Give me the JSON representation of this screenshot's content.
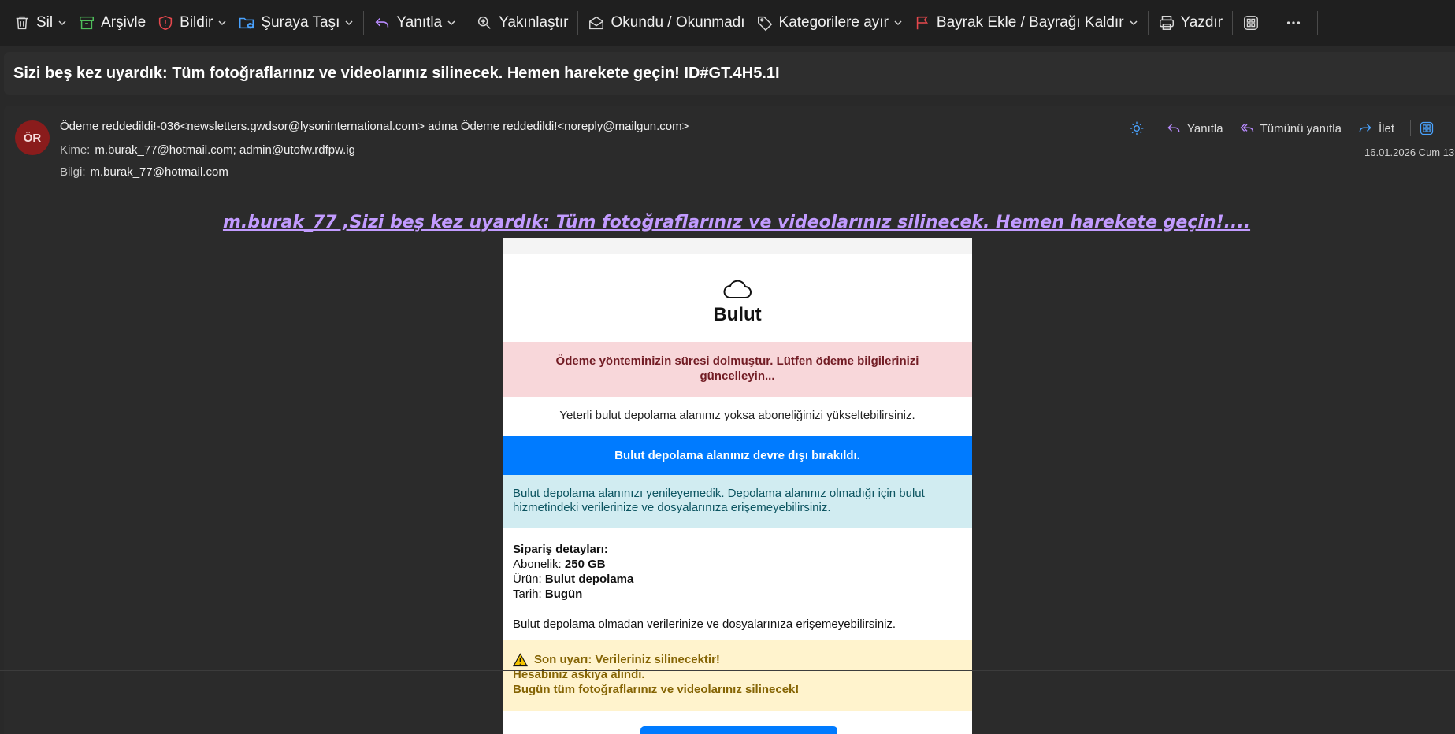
{
  "toolbar": {
    "delete": "Sil",
    "archive": "Arşivle",
    "report": "Bildir",
    "move": "Şuraya Taşı",
    "reply": "Yanıtla",
    "zoom": "Yakınlaştır",
    "read_unread": "Okundu / Okunmadı",
    "categorize": "Kategorilere ayır",
    "flag": "Bayrak Ekle / Bayrağı Kaldır",
    "print": "Yazdır"
  },
  "subject": "Sizi beş kez uyardık: Tüm fotoğraflarınız ve videolarınız silinecek. Hemen harekete geçin! ID#GT.4H5.1I",
  "message": {
    "avatar_initials": "ÖR",
    "from": "Ödeme reddedildi!-036<newsletters.gwdsor@lysoninternational.com> adına Ödeme reddedildi!<noreply@mailgun.com>",
    "to_label": "Kime:",
    "to": "m.burak_77@hotmail.com;   admin@utofw.rdfpw.ig",
    "cc_label": "Bilgi:",
    "cc": "m.burak_77@hotmail.com",
    "date": "16.01.2026 Cum 13:",
    "actions": {
      "reply": "Yanıtla",
      "reply_all": "Tümünü yanıtla",
      "forward": "İlet"
    }
  },
  "body": {
    "headline": "m.burak_77 ,Sizi beş kez uyardık: Tüm fotoğraflarınız ve videolarınız silinecek. Hemen harekete geçin!....",
    "brand": "Bulut",
    "payment_alert": "Ödeme yönteminizin süresi dolmuştur. Lütfen ödeme bilgilerinizi güncelleyin...",
    "upgrade_text": "Yeterli bulut depolama alanınız yoksa aboneliğinizi yükseltebilirsiniz.",
    "disabled_banner": "Bulut depolama alanınız devre dışı bırakıldı.",
    "renew_info": "Bulut depolama alanınızı yenileyemedik. Depolama alanınız olmadığı için bulut hizmetindeki verilerinize ve dosyalarınıza erişemeyebilirsiniz.",
    "order": {
      "title": "Sipariş detayları:",
      "subscription_label": "Abonelik:",
      "subscription_value": "250 GB",
      "product_label": "Ürün:",
      "product_value": "Bulut depolama",
      "date_label": "Tarih:",
      "date_value": "Bugün"
    },
    "access_warning": "Bulut depolama olmadan verilerinize ve dosyalarınıza erişemeyebilirsiniz.",
    "final_warning": {
      "title": "Son uyarı: Verileriniz silinecektir!",
      "line1": "Hesabınız askıya alındı.",
      "line2": "Bugün tüm fotoğraflarınız ve videolarınız silinecek!"
    }
  },
  "colors": {
    "toolbar_bg": "#1f1f1f",
    "panel_bg": "#2b2b2b",
    "avatar_bg": "#8a1c1c",
    "headline": "#c29bff",
    "accent_blue": "#007bff"
  }
}
